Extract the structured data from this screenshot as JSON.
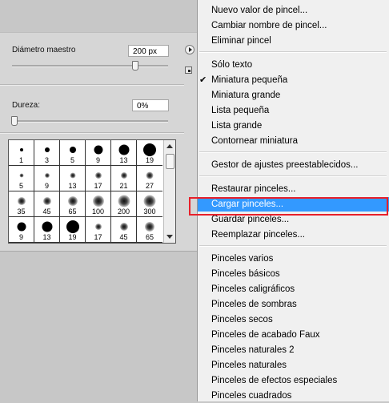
{
  "brush_panel": {
    "master_diameter_label": "Diámetro maestro",
    "master_diameter_value": "200 px",
    "master_diameter_slider_fraction": 0.8,
    "hardness_label": "Dureza:",
    "hardness_value": "0%",
    "hardness_slider_fraction": 0.0,
    "scroll_position_fraction": 0.0,
    "flyout_icon": "triangle-right-icon",
    "new_preset_icon": "small-square-icon",
    "brushes": [
      {
        "size": "1",
        "kind": "hard"
      },
      {
        "size": "3",
        "kind": "hard"
      },
      {
        "size": "5",
        "kind": "hard"
      },
      {
        "size": "9",
        "kind": "hard"
      },
      {
        "size": "13",
        "kind": "hard"
      },
      {
        "size": "19",
        "kind": "hard"
      },
      {
        "size": "5",
        "kind": "soft"
      },
      {
        "size": "9",
        "kind": "soft"
      },
      {
        "size": "13",
        "kind": "soft"
      },
      {
        "size": "17",
        "kind": "soft"
      },
      {
        "size": "21",
        "kind": "soft"
      },
      {
        "size": "27",
        "kind": "soft"
      },
      {
        "size": "35",
        "kind": "soft"
      },
      {
        "size": "45",
        "kind": "soft"
      },
      {
        "size": "65",
        "kind": "soft"
      },
      {
        "size": "100",
        "kind": "soft"
      },
      {
        "size": "200",
        "kind": "soft"
      },
      {
        "size": "300",
        "kind": "soft"
      },
      {
        "size": "9",
        "kind": "hard"
      },
      {
        "size": "13",
        "kind": "hard"
      },
      {
        "size": "19",
        "kind": "hard"
      },
      {
        "size": "17",
        "kind": "soft"
      },
      {
        "size": "45",
        "kind": "soft"
      },
      {
        "size": "65",
        "kind": "soft"
      }
    ]
  },
  "menu": {
    "highlight_color": "#3399ff",
    "annotation_box_color": "#e8202a",
    "check_mark": "✔",
    "items": [
      {
        "label": "Nuevo valor de pincel..."
      },
      {
        "label": "Cambiar nombre de pincel..."
      },
      {
        "label": "Eliminar pincel"
      },
      {
        "label": "Sólo texto"
      },
      {
        "label": "Miniatura pequeña",
        "checked": true
      },
      {
        "label": "Miniatura grande"
      },
      {
        "label": "Lista pequeña"
      },
      {
        "label": "Lista grande"
      },
      {
        "label": "Contornear miniatura"
      },
      {
        "label": "Gestor de ajustes preestablecidos..."
      },
      {
        "label": "Restaurar pinceles..."
      },
      {
        "label": "Cargar pinceles...",
        "highlighted": true
      },
      {
        "label": "Guardar pinceles..."
      },
      {
        "label": "Reemplazar pinceles..."
      },
      {
        "label": "Pinceles varios"
      },
      {
        "label": "Pinceles básicos"
      },
      {
        "label": "Pinceles caligráficos"
      },
      {
        "label": "Pinceles de sombras"
      },
      {
        "label": "Pinceles secos"
      },
      {
        "label": "Pinceles de acabado Faux"
      },
      {
        "label": "Pinceles naturales 2"
      },
      {
        "label": "Pinceles naturales"
      },
      {
        "label": "Pinceles de efectos especiales"
      },
      {
        "label": "Pinceles cuadrados"
      }
    ]
  }
}
